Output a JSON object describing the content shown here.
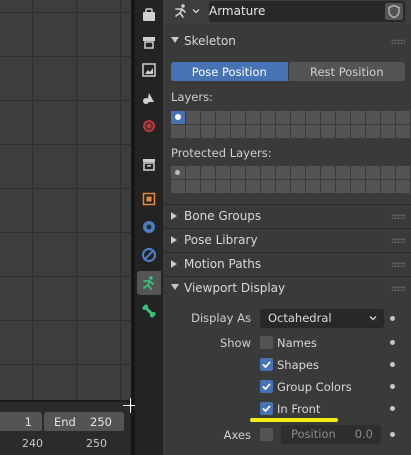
{
  "timeline": {
    "start_value": "1",
    "end_label": "End",
    "end_value": "250",
    "ruler_numbers": [
      "240",
      "250"
    ]
  },
  "header": {
    "object_name": "Armature"
  },
  "tabs": [
    {
      "name": "tool",
      "icon": "tool-icon",
      "active": false
    },
    {
      "name": "render",
      "icon": "render-icon",
      "active": false
    },
    {
      "name": "output",
      "icon": "output-icon",
      "active": false
    },
    {
      "name": "scene",
      "icon": "scene-icon",
      "active": false
    },
    {
      "name": "world",
      "icon": "world-icon",
      "active": false
    },
    {
      "name": "collection",
      "icon": "collection-icon",
      "active": false
    },
    {
      "name": "object",
      "icon": "object-icon",
      "active": false
    },
    {
      "name": "modifiers",
      "icon": "constraint-icon",
      "active": false
    },
    {
      "name": "physics",
      "icon": "physics-icon",
      "active": false
    },
    {
      "name": "armature-data",
      "icon": "armature-icon",
      "active": true
    },
    {
      "name": "bone",
      "icon": "bone-icon",
      "active": false
    }
  ],
  "skeleton": {
    "title": "Skeleton",
    "pose_position_label": "Pose Position",
    "rest_position_label": "Rest Position",
    "pose_mode": "Pose Position",
    "layers_label": "Layers:",
    "protected_layers_label": "Protected Layers:"
  },
  "collapsed_sections": [
    {
      "title": "Bone Groups"
    },
    {
      "title": "Pose Library"
    },
    {
      "title": "Motion Paths"
    }
  ],
  "viewport_display": {
    "title": "Viewport Display",
    "display_as_label": "Display As",
    "display_as_value": "Octahedral",
    "show_label": "Show",
    "names_label": "Names",
    "names_checked": false,
    "shapes_label": "Shapes",
    "shapes_checked": true,
    "group_colors_label": "Group Colors",
    "group_colors_checked": true,
    "in_front_label": "In Front",
    "in_front_checked": true,
    "axes_label": "Axes",
    "axes_checked": false,
    "position_label": "Position",
    "position_value": "0.0"
  },
  "colors": {
    "accent_blue": "#4772b3",
    "highlight_yellow": "#f3ed16",
    "armature_green": "#35c27a"
  }
}
